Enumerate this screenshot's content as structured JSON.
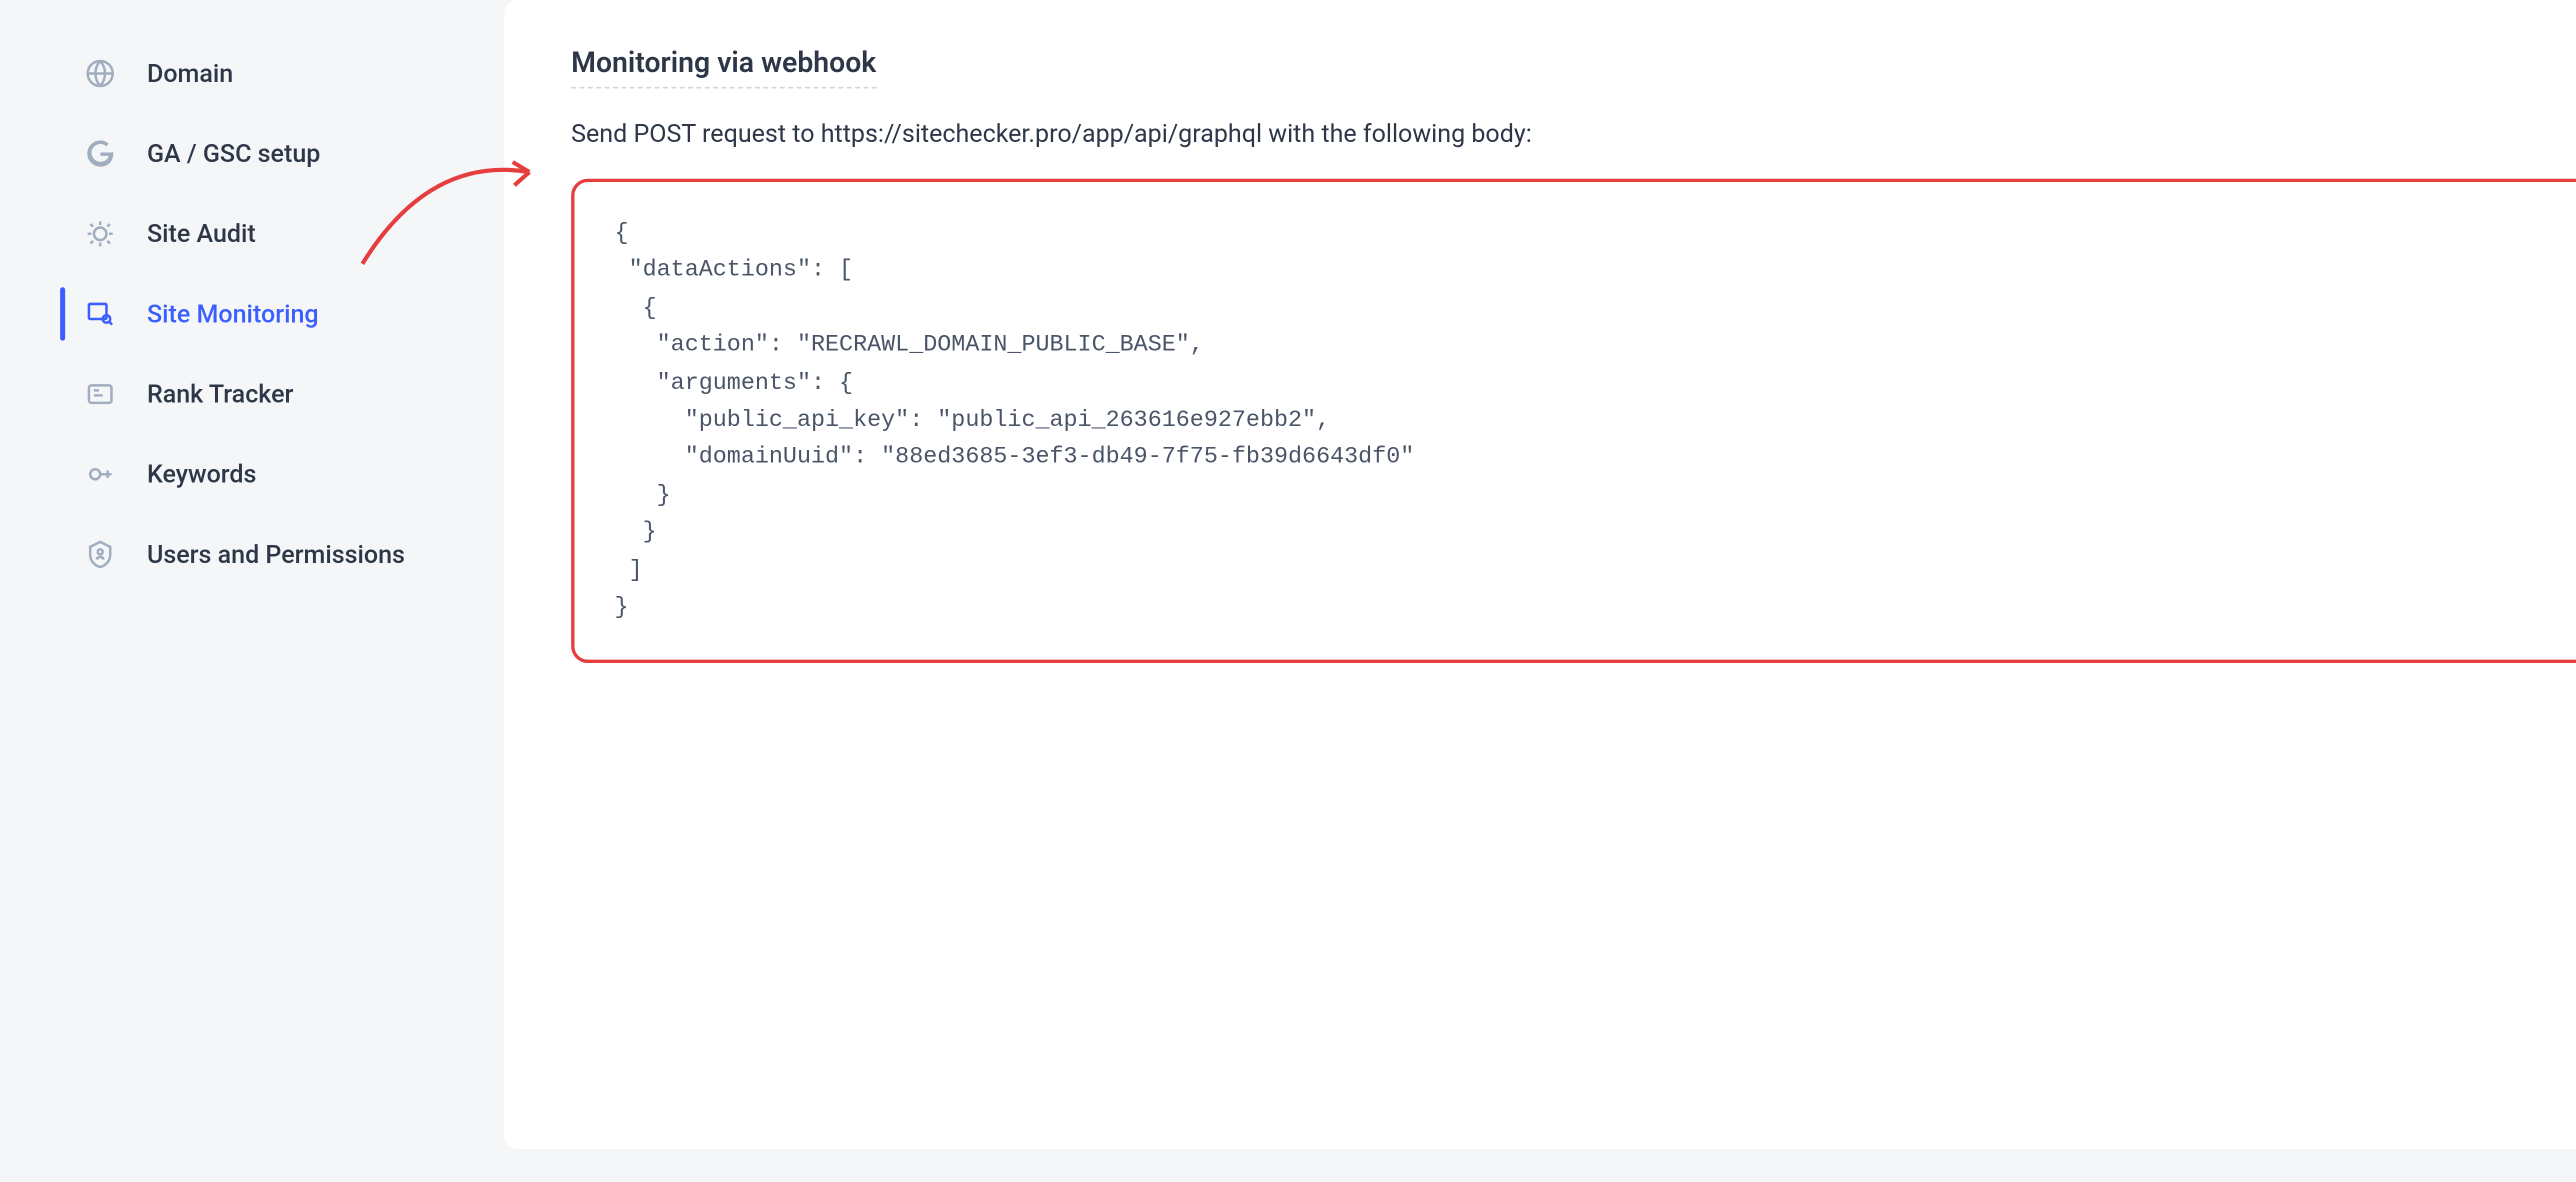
{
  "sidebar": {
    "items": [
      {
        "label": "Domain"
      },
      {
        "label": "GA / GSC setup"
      },
      {
        "label": "Site Audit"
      },
      {
        "label": "Site Monitoring"
      },
      {
        "label": "Rank Tracker"
      },
      {
        "label": "Keywords"
      },
      {
        "label": "Users and Permissions"
      }
    ]
  },
  "main": {
    "title": "Monitoring via webhook",
    "description": "Send POST request to https://sitechecker.pro/app/api/graphql with the following body:",
    "code": "{\n \"dataActions\": [\n  {\n   \"action\": \"RECRAWL_DOMAIN_PUBLIC_BASE\",\n   \"arguments\": {\n     \"public_api_key\": \"public_api_263616e927ebb2\",\n     \"domainUuid\": \"88ed3685-3ef3-db49-7f75-fb39d6643df0\"\n   }\n  }\n ]\n}"
  }
}
